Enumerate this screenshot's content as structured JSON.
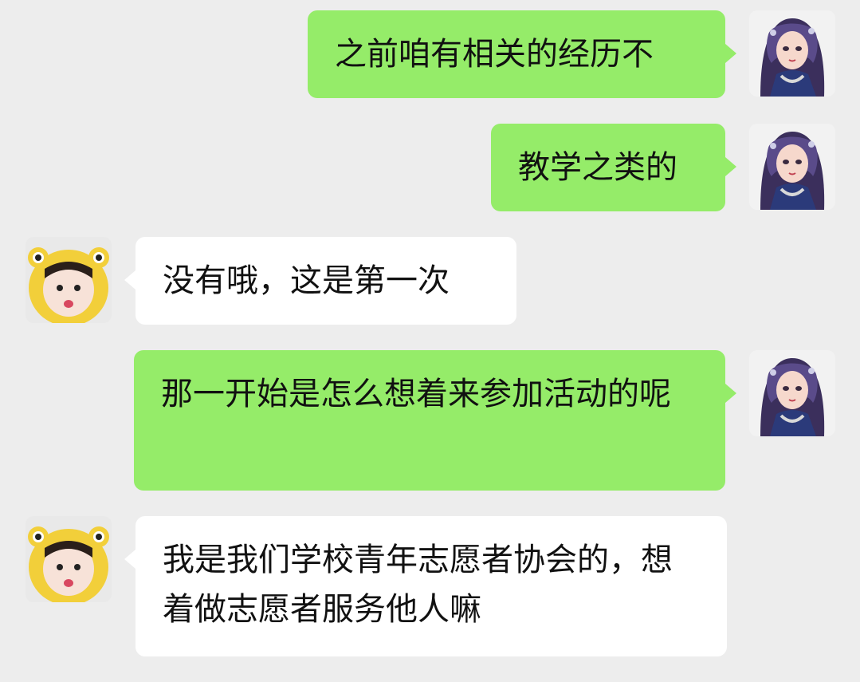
{
  "colors": {
    "background": "#ededed",
    "sent_bubble": "#95ec69",
    "received_bubble": "#ffffff",
    "text": "#111111"
  },
  "messages": [
    {
      "sender": "me",
      "avatar": "anime-girl-avatar",
      "text": "之前咱有相关的经历不"
    },
    {
      "sender": "me",
      "avatar": "anime-girl-avatar",
      "text": "教学之类的"
    },
    {
      "sender": "other",
      "avatar": "baby-frog-hat-avatar",
      "text": "没有哦，这是第一次"
    },
    {
      "sender": "me",
      "avatar": "anime-girl-avatar",
      "text": "那一开始是怎么想着来参加活动的呢"
    },
    {
      "sender": "other",
      "avatar": "baby-frog-hat-avatar",
      "text": "我是我们学校青年志愿者协会的，想着做志愿者服务他人嘛"
    }
  ]
}
